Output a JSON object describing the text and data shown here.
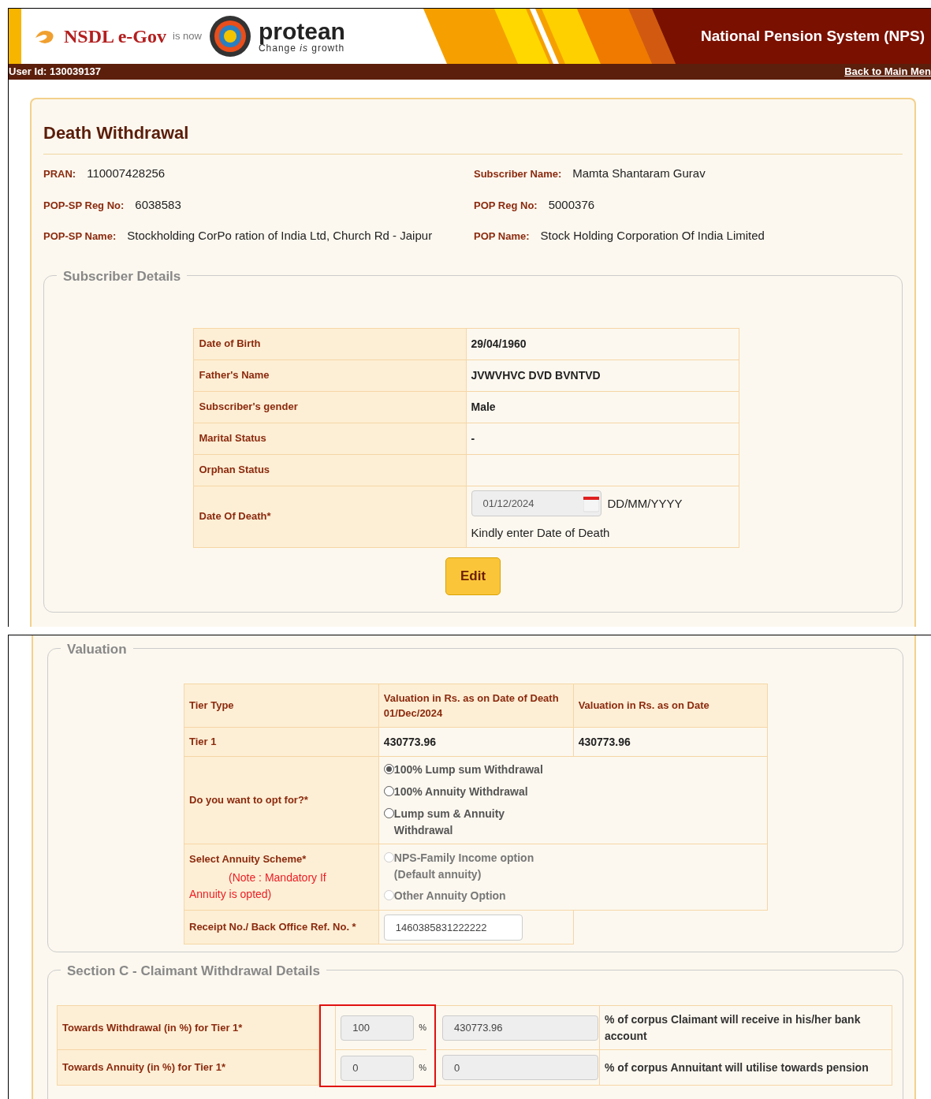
{
  "header": {
    "logo_text": "NSDL e-Gov",
    "is_now": "is now",
    "brand": "protean",
    "tagline": "Change *is* growth",
    "title": "National Pension System (NPS)",
    "user_id": "User Id: 130039137",
    "back_link": "Back to Main Men"
  },
  "page_title": "Death Withdrawal",
  "info": [
    {
      "label": "PRAN:",
      "value": "110007428256"
    },
    {
      "label": "Subscriber Name:",
      "value": "Mamta Shantaram Gurav"
    },
    {
      "label": "POP-SP Reg No:",
      "value": "6038583"
    },
    {
      "label": "POP Reg No:",
      "value": "5000376"
    },
    {
      "label": "POP-SP Name:",
      "value": "Stockholding CorPo ration of India Ltd, Church Rd - Jaipur"
    },
    {
      "label": "POP Name:",
      "value": "Stock Holding Corporation Of India Limited"
    }
  ],
  "subscriber_details": {
    "legend": "Subscriber Details",
    "rows": [
      {
        "kind": "text",
        "label": "Date of Birth",
        "value": "29/04/1960"
      },
      {
        "kind": "text",
        "label": "Father's Name",
        "value": "JVWVHVC DVD BVNTVD"
      },
      {
        "kind": "text",
        "label": "Subscriber's gender",
        "value": "Male"
      },
      {
        "kind": "text",
        "label": "Marital Status",
        "value": "-"
      },
      {
        "kind": "text",
        "label": "Orphan Status"
      },
      {
        "kind": "date",
        "label": "Date Of Death*",
        "value": "01/12/2024",
        "format": "DD/MM/YYYY",
        "hint": "Kindly enter Date of Death"
      }
    ],
    "edit_button": "Edit"
  },
  "valuation": {
    "legend": "Valuation",
    "columns": [
      "Tier Type",
      "Valuation in Rs. as on Date of Death 01/Dec/2024",
      "Valuation in Rs. as on Date"
    ],
    "tier_row": [
      "Tier 1",
      "430773.96",
      "430773.96"
    ],
    "opt_for": {
      "label": "Do you want to opt for?*",
      "options": [
        {
          "label": "100% Lump sum Withdrawal",
          "selected": true,
          "disabled": false
        },
        {
          "label": "100% Annuity Withdrawal",
          "selected": false,
          "disabled": false
        },
        {
          "label": "Lump sum & Annuity Withdrawal",
          "selected": false,
          "disabled": false
        }
      ]
    },
    "annuity_scheme": {
      "label": "Select Annuity Scheme*",
      "note": "(Note : Mandatory If Annuity is opted)",
      "options": [
        {
          "label": "NPS-Family Income option (Default annuity)",
          "selected": false,
          "disabled": true
        },
        {
          "label": "Other Annuity Option",
          "selected": false,
          "disabled": true
        }
      ]
    },
    "receipt": {
      "label": "Receipt No./ Back Office Ref. No. *",
      "value": "1460385831222222"
    }
  },
  "section_c": {
    "legend": "Section C - Claimant Withdrawal Details",
    "rows": [
      {
        "label": "Towards Withdrawal (in %) for Tier 1*",
        "percent": "100",
        "unit": "%",
        "amount": "430773.96",
        "description": "% of corpus Claimant will receive in his/her bank account"
      },
      {
        "label": "Towards Annuity (in %) for Tier 1*",
        "percent": "0",
        "unit": "%",
        "amount": "0",
        "description": "% of corpus Annuitant will utilise towards pension"
      }
    ]
  }
}
